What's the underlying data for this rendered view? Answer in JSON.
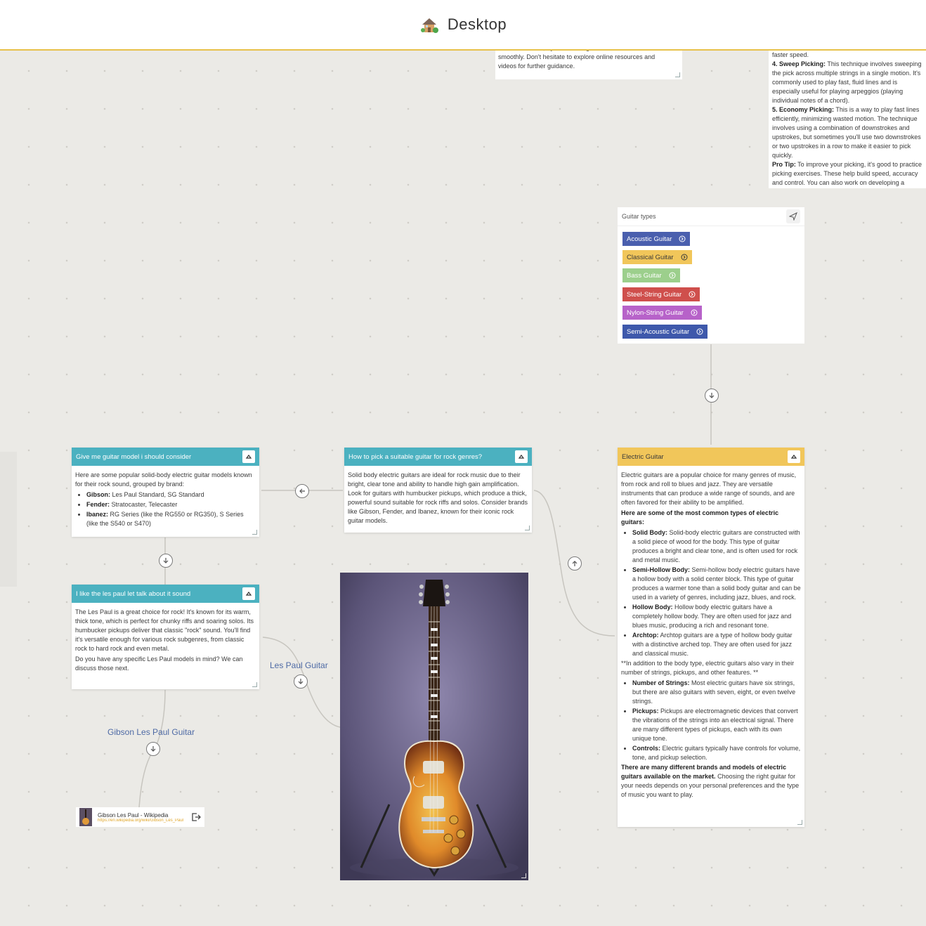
{
  "header": {
    "title": "Desktop"
  },
  "fragments": {
    "top_center": [
      "feel comfortable, try transitioning between chords",
      "smoothly. Don't hesitate to explore online resources and",
      "videos for further guidance."
    ],
    "top_right": {
      "line0": "faster speed.",
      "sweep_title": "4. Sweep Picking:",
      "sweep_text": " This technique involves sweeping the pick across multiple strings in a single motion. It's commonly used to play fast, fluid lines and is especially useful for playing arpeggios (playing individual notes of a chord).",
      "economy_title": "5. Economy Picking:",
      "economy_text": " This is a way to play fast lines efficiently, minimizing wasted motion. The technique involves using a combination of downstrokes and upstrokes, but sometimes you'll use two downstrokes or two upstrokes in a row to make it easier to pick quickly.",
      "tip_title": "Pro Tip:",
      "tip_text": " To improve your picking, it's good to practice picking exercises. These help build speed, accuracy and control. You can also work on developing a consistent picking hand position and a relaxed grip."
    }
  },
  "guitar_types": {
    "input_label": "Guitar types",
    "chips": [
      {
        "label": "Acoustic Guitar",
        "color": "#4a5fae"
      },
      {
        "label": "Classical Guitar",
        "color": "#f1c65a",
        "text_color": "#3a3a3a"
      },
      {
        "label": "Bass Guitar",
        "color": "#9ccf8c"
      },
      {
        "label": "Steel-String Guitar",
        "color": "#cf4f4c"
      },
      {
        "label": "Nylon-String Guitar",
        "color": "#b762c9"
      },
      {
        "label": "Semi-Acoustic Guitar",
        "color": "#3e58ab"
      }
    ]
  },
  "electric": {
    "title": "Electric Guitar",
    "intro": "Electric guitars are a popular choice for many genres of music, from rock and roll to blues and jazz. They are versatile instruments that can produce a wide range of sounds, and are often favored for their ability to be amplified.",
    "types_heading": "Here are some of the most common types of electric guitars:",
    "types": [
      {
        "name": "Solid Body:",
        "text": " Solid-body electric guitars are constructed with a solid piece of wood for the body. This type of guitar produces a bright and clear tone, and is often used for rock and metal music."
      },
      {
        "name": "Semi-Hollow Body:",
        "text": " Semi-hollow body electric guitars have a hollow body with a solid center block. This type of guitar produces a warmer tone than a solid body guitar and can be used in a variety of genres, including jazz, blues, and rock."
      },
      {
        "name": "Hollow Body:",
        "text": " Hollow body electric guitars have a completely hollow body. They are often used for jazz and blues music, producing a rich and resonant tone."
      },
      {
        "name": "Archtop:",
        "text": " Archtop guitars are a type of hollow body guitar with a distinctive arched top. They are often used for jazz and classical music."
      }
    ],
    "features_heading": "**In addition to the body type, electric guitars also vary in their number of strings, pickups, and other features. **",
    "features": [
      {
        "name": "Number of Strings:",
        "text": " Most electric guitars have six strings, but there are also guitars with seven, eight, or even twelve strings."
      },
      {
        "name": "Pickups:",
        "text": " Pickups are electromagnetic devices that convert the vibrations of the strings into an electrical signal. There are many different types of pickups, each with its own unique tone."
      },
      {
        "name": "Controls:",
        "text": " Electric guitars typically have controls for volume, tone, and pickup selection."
      }
    ],
    "outro_bold": "There are many different brands and models of electric guitars available on the market.",
    "outro_text": " Choosing the right guitar for your needs depends on your personal preferences and the type of music you want to play."
  },
  "rock": {
    "title": "How to pick a suitable guitar for rock genres?",
    "body": "Solid body electric guitars are ideal for rock music due to their bright, clear tone and ability to handle high gain amplification.  Look for guitars with humbucker pickups, which produce a thick, powerful sound suitable for rock riffs and solos. Consider brands like Gibson, Fender, and Ibanez, known for their iconic rock guitar models."
  },
  "models": {
    "title": "Give me guitar model i should consider",
    "intro": "Here are some popular solid-body electric guitar models known for their rock sound, grouped by brand:",
    "items": [
      {
        "brand": "Gibson:",
        "text": " Les Paul Standard, SG Standard"
      },
      {
        "brand": "Fender:",
        "text": " Stratocaster, Telecaster"
      },
      {
        "brand": "Ibanez:",
        "text": " RG Series (like the RG550 or RG350), S Series (like the S540 or S470)"
      }
    ]
  },
  "lespaul": {
    "title": "I like the les paul let talk about it sound",
    "body": "The Les Paul is a great choice for rock! It's known for its warm, thick tone, which is perfect for chunky riffs and soaring solos. Its humbucker pickups deliver that classic \"rock\" sound. You'll find it's versatile enough for various rock subgenres, from classic rock to hard rock and even metal.",
    "question": "Do you have any specific Les Paul models in mind?  We can discuss those next."
  },
  "labels": {
    "les_paul_guitar": "Les Paul Guitar",
    "gibson_les_paul_guitar": "Gibson Les Paul Guitar"
  },
  "link": {
    "title": "Gibson Les Paul - Wikipedia",
    "url": "https://en.wikipedia.org/wiki/Gibson_Les_Paul"
  },
  "colors": {
    "teal_header": "#4bb1c0",
    "yellow_header": "#f1c65a",
    "accent_line": "#e7c14a",
    "canvas": "#ebeae6"
  }
}
